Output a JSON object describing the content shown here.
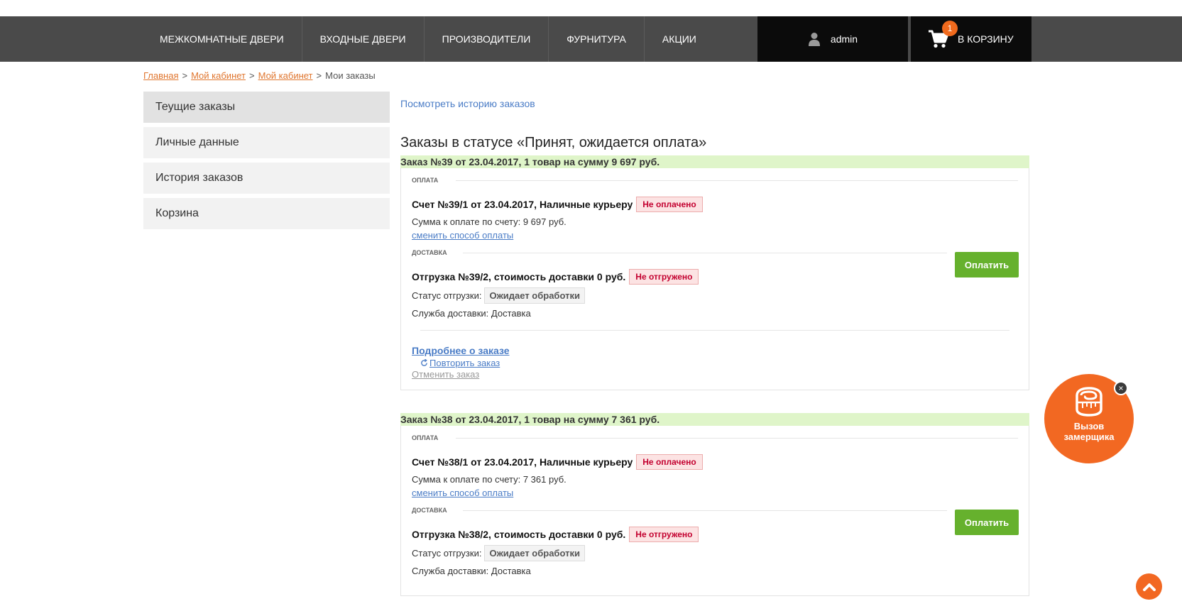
{
  "nav": {
    "items": [
      {
        "label": "Межкомнатные двери"
      },
      {
        "label": "Входные двери"
      },
      {
        "label": "Производители"
      },
      {
        "label": "Фурнитура"
      },
      {
        "label": "Акции"
      }
    ],
    "user": "admin",
    "cart_label": "В корзину",
    "cart_count": "1"
  },
  "breadcrumb": {
    "items": [
      "Главная",
      "Мой кабинет",
      "Мой кабинет"
    ],
    "current": "Мои заказы",
    "separator": ">"
  },
  "sidebar": {
    "items": [
      {
        "label": "Теущие заказы",
        "active": true
      },
      {
        "label": "Личные данные"
      },
      {
        "label": "История заказов"
      },
      {
        "label": "Корзина"
      }
    ]
  },
  "main": {
    "history_link": "Посмотреть историю заказов",
    "status_title": "Заказы в статусе «Принят, ожидается оплата»"
  },
  "orders": [
    {
      "header": "Заказ №39 от 23.04.2017, 1 товар на сумму 9 697 руб.",
      "payment_label": "ОПЛАТА",
      "invoice_title": "Счет №39/1 от 23.04.2017, Наличные курьеру",
      "invoice_status": "Не оплачено",
      "sum_text": "Сумма к оплате по счету: 9 697 руб.",
      "change_payment": "сменить способ оплаты",
      "pay_button": "Оплатить",
      "delivery_label": "ДОСТАВКА",
      "shipment_title": "Отгрузка №39/2, стоимость доставки 0 руб.",
      "shipment_status": "Не отгружено",
      "shipment_state_label": "Статус отгрузки:",
      "shipment_state": "Ожидает обработки",
      "service_text": "Служба доставки: Доставка",
      "details_link": "Подробнее о заказе",
      "repeat_link": "Повторить заказ",
      "cancel_link": "Отменить заказ"
    },
    {
      "header": "Заказ №38 от 23.04.2017, 1 товар на сумму 7 361 руб.",
      "payment_label": "ОПЛАТА",
      "invoice_title": "Счет №38/1 от 23.04.2017, Наличные курьеру",
      "invoice_status": "Не оплачено",
      "sum_text": "Сумма к оплате по счету: 7 361 руб.",
      "change_payment": "сменить способ оплаты",
      "pay_button": "Оплатить",
      "delivery_label": "ДОСТАВКА",
      "shipment_title": "Отгрузка №38/2, стоимость доставки 0 руб.",
      "shipment_status": "Не отгружено",
      "shipment_state_label": "Статус отгрузки:",
      "shipment_state": "Ожидает обработки",
      "service_text": "Служба доставки: Доставка"
    }
  ],
  "floating": {
    "measure_label_line1": "Вызов",
    "measure_label_line2": "замерщика",
    "close_symbol": "×"
  },
  "colors": {
    "nav_bg": "#4a4a4a",
    "accent": "#f26822",
    "pay_green": "#66b12d",
    "order_header": "#dff5c9",
    "link_blue": "#4a7cc6"
  }
}
